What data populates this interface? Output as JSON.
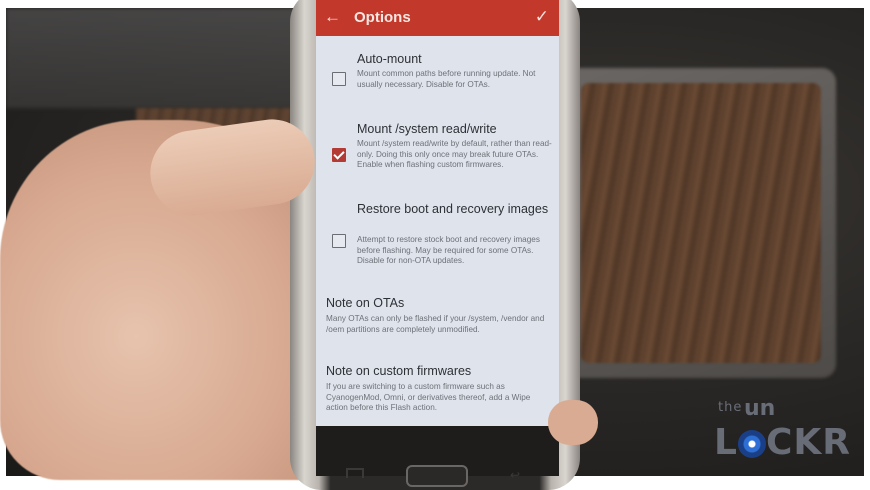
{
  "app": {
    "toolbar": {
      "back_icon": "arrow-left-icon",
      "title": "Options",
      "confirm_icon": "check-icon",
      "color": "#c2392c"
    }
  },
  "options": [
    {
      "title": "Auto-mount",
      "description": "Mount common paths before running update. Not usually necessary. Disable for OTAs.",
      "checked": false
    },
    {
      "title": "Mount /system read/write",
      "description": "Mount /system read/write by default, rather than read-only. Doing this only once may break future OTAs. Enable when flashing custom firmwares.",
      "checked": true
    },
    {
      "title": "Restore boot and recovery images",
      "description": "Attempt to restore stock boot and recovery images before flashing. May be required for some OTAs. Disable for non-OTA updates.",
      "checked": false
    }
  ],
  "notes": [
    {
      "title": "Note on OTAs",
      "body": "Many OTAs can only be flashed if your /system, /vendor and /oem partitions are completely unmodified."
    },
    {
      "title": "Note on custom firmwares",
      "body": "If you are switching to a custom firmware such as CyanogenMod, Omni, or derivatives thereof, add a Wipe action before this Flash action."
    }
  ],
  "watermark": {
    "line1": "the",
    "line2": "un",
    "line3_prefix": "L",
    "line3_suffix": "CKR"
  }
}
